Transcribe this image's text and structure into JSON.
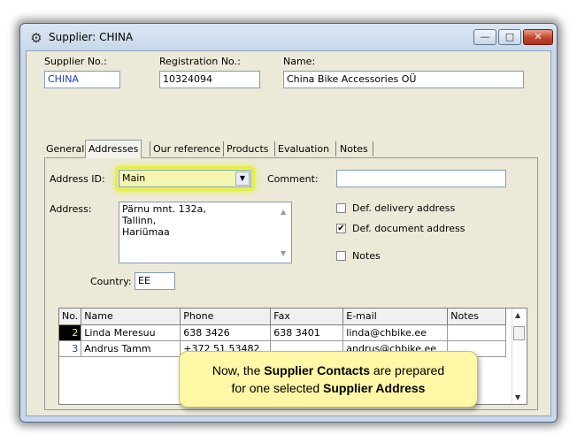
{
  "window": {
    "title": "Supplier: CHINA",
    "app_icon": "gear-icon"
  },
  "title_buttons": {
    "minimize": "—",
    "maximize": "□",
    "close": "✕"
  },
  "header": {
    "supplier_no_label": "Supplier No.:",
    "supplier_no_value": "CHINA",
    "registration_label": "Registration No.:",
    "registration_value": "10324094",
    "name_label": "Name:",
    "name_value": "China Bike Accessories OÜ"
  },
  "tabs": [
    {
      "label": "General"
    },
    {
      "label": "Addresses",
      "active": true
    },
    {
      "label": "Our reference"
    },
    {
      "label": "Products"
    },
    {
      "label": "Evaluation"
    },
    {
      "label": "Notes"
    }
  ],
  "address": {
    "id_label": "Address ID:",
    "id_value": "Main",
    "comment_label": "Comment:",
    "comment_value": "",
    "address_label": "Address:",
    "address_lines": [
      "Pärnu mnt. 132a,",
      "Tallinn,",
      "Hariümaa"
    ],
    "country_label": "Country:",
    "country_value": "EE",
    "checkboxes": [
      {
        "label": "Def. delivery address",
        "checked": false
      },
      {
        "label": "Def. document address",
        "checked": true
      },
      {
        "label": "Notes",
        "checked": false
      }
    ]
  },
  "contacts": {
    "columns": [
      "No.",
      "Name",
      "Phone",
      "Fax",
      "E-mail",
      "Notes"
    ],
    "rows": [
      {
        "no": "2",
        "name": "Linda Meresuu",
        "phone": "638 3426",
        "fax": "638 3401",
        "email": "linda@chbike.ee",
        "notes": "",
        "selected": true
      },
      {
        "no": "3",
        "name": "Andrus Tamm",
        "phone": "+372 51 53482",
        "fax": "",
        "email": "andrus@chbike.ee",
        "notes": "",
        "selected": false
      }
    ]
  },
  "callout": {
    "line1_pre": "Now, the ",
    "line1_bold": "Supplier Contacts",
    "line1_post": " are prepared",
    "line2_pre": "for one selected ",
    "line2_bold": "Supplier Address"
  },
  "colors": {
    "highlight": "#e5f044",
    "callout_bg": "#fdf7a6",
    "selected_no_bg": "#000000",
    "selected_no_fg": "#ffff00"
  }
}
